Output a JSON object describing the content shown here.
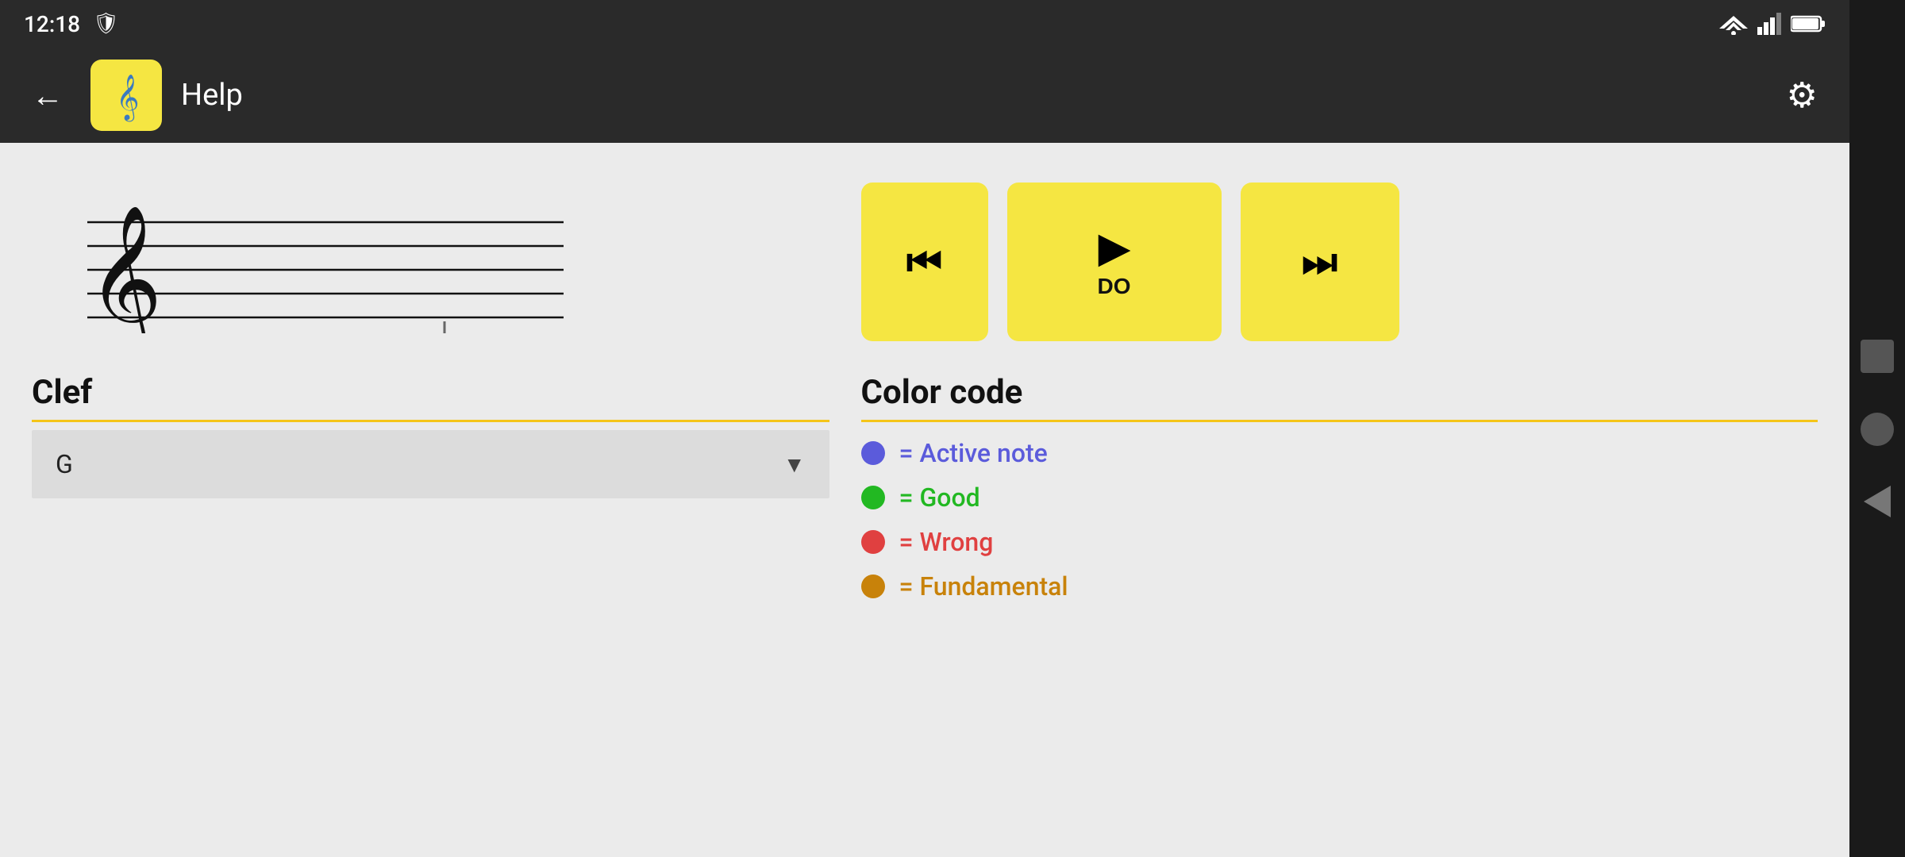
{
  "statusBar": {
    "time": "12:18",
    "shieldIcon": "🛡"
  },
  "appBar": {
    "backLabel": "←",
    "title": "Help",
    "gearIcon": "⚙"
  },
  "playback": {
    "prevLabel": "⏮",
    "playLabel": "▶",
    "noteLabel": "DO",
    "nextLabel": "⏭"
  },
  "clef": {
    "sectionTitle": "Clef",
    "selectedValue": "G"
  },
  "colorCode": {
    "sectionTitle": "Color code",
    "items": [
      {
        "color": "active",
        "label": "= Active note"
      },
      {
        "color": "good",
        "label": "= Good"
      },
      {
        "color": "wrong",
        "label": "= Wrong"
      },
      {
        "color": "fundamental",
        "label": "= Fundamental"
      }
    ]
  }
}
